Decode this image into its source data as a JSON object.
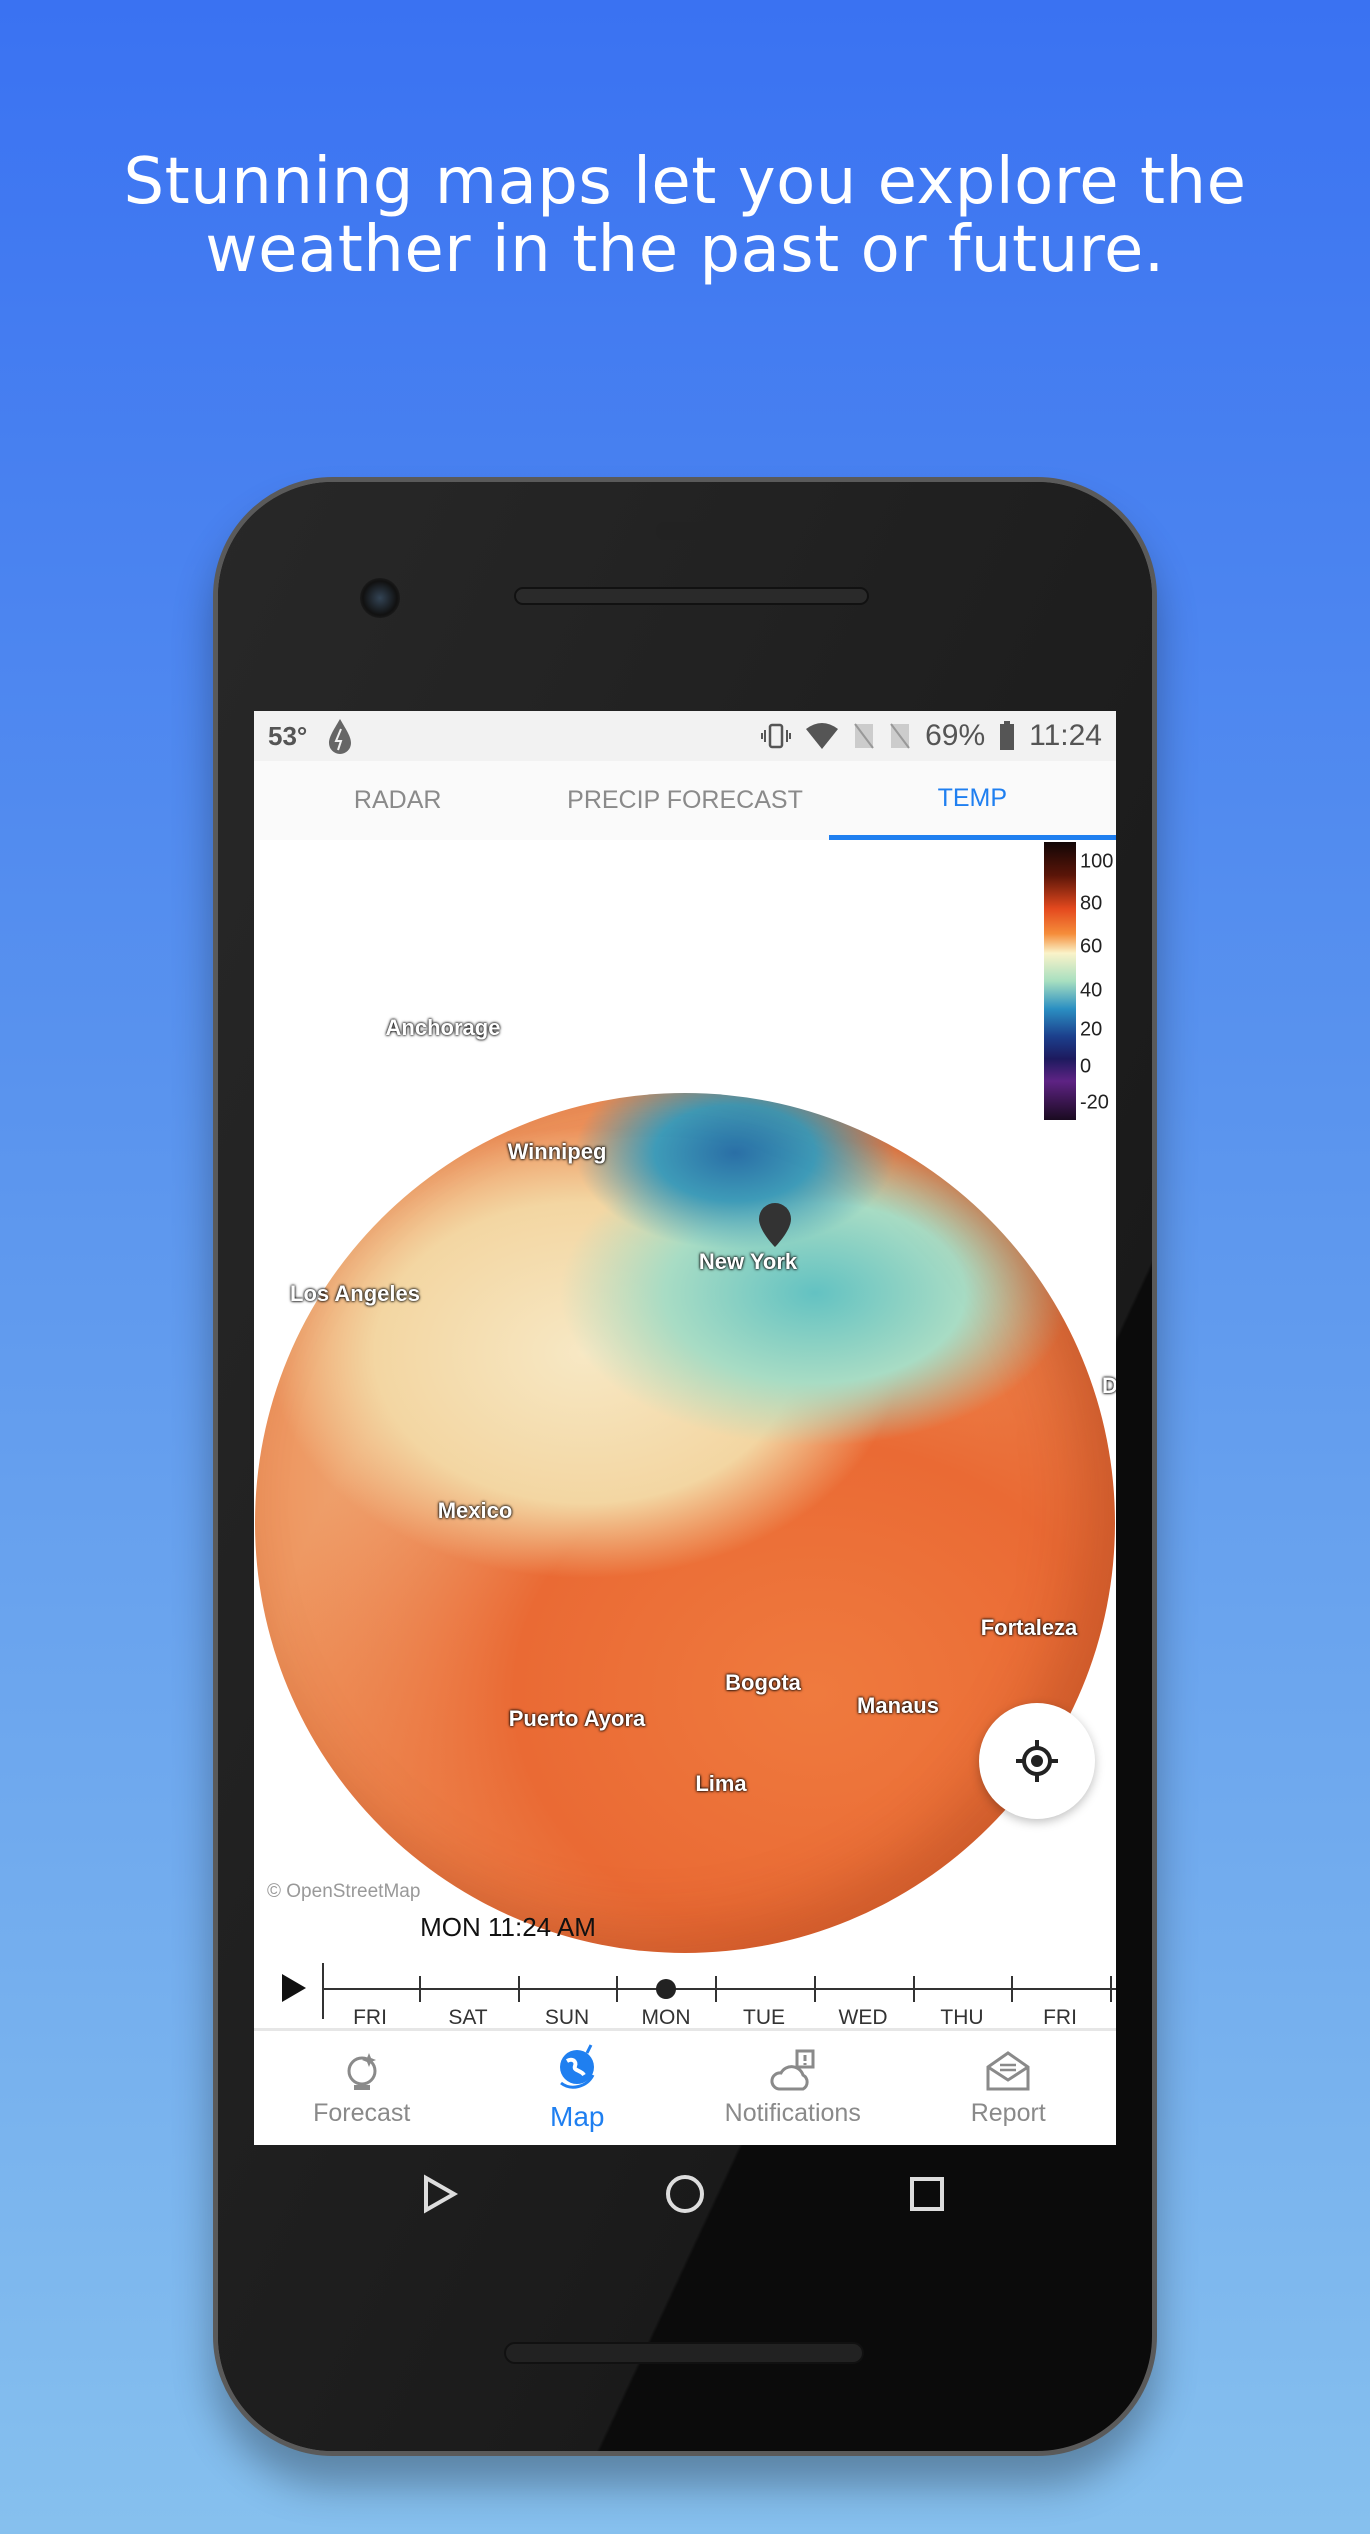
{
  "headline": {
    "line1": "Stunning maps let you explore the",
    "line2": "weather in the past or future."
  },
  "status_bar": {
    "temperature": "53°",
    "battery": "69%",
    "time": "11:24",
    "icons": [
      "weather-drop-icon",
      "vibrate-icon",
      "wifi-icon",
      "no-sim-icon",
      "no-sim-icon",
      "battery-icon"
    ]
  },
  "tabs": [
    {
      "label": "RADAR",
      "active": false
    },
    {
      "label": "PRECIP FORECAST",
      "active": false
    },
    {
      "label": "TEMP",
      "active": true
    }
  ],
  "accent_color": "#1f7ff0",
  "legend": {
    "values": [
      "100",
      "80",
      "60",
      "40",
      "20",
      "0",
      "-20"
    ]
  },
  "map": {
    "cities": [
      "Anchorage",
      "Winnipeg",
      "Los Angeles",
      "New York",
      "Mexico",
      "Fortaleza",
      "Bogota",
      "Manaus",
      "Puerto Ayora",
      "Lima",
      "Da"
    ],
    "attribution": "© OpenStreetMap"
  },
  "timeline": {
    "current": "MON 11:24 AM",
    "days": [
      "FRI",
      "SAT",
      "SUN",
      "MON",
      "TUE",
      "WED",
      "THU",
      "FRI"
    ],
    "selected_day": "MON"
  },
  "bottom_nav": [
    {
      "label": "Forecast",
      "icon": "crystal-ball-icon"
    },
    {
      "label": "Map",
      "icon": "globe-icon",
      "active": true
    },
    {
      "label": "Notifications",
      "icon": "cloud-alert-icon"
    },
    {
      "label": "Report",
      "icon": "envelope-icon"
    }
  ]
}
